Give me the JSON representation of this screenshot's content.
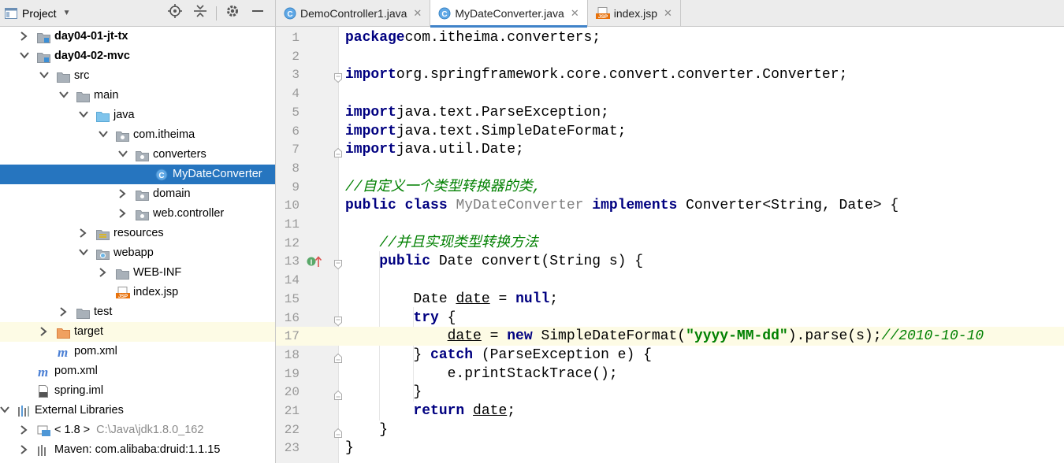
{
  "project_panel": {
    "title": "Project",
    "tools": [
      "locate-icon",
      "collapse-icon",
      "gear-icon",
      "hide-icon"
    ],
    "tree": [
      {
        "label": "day04-01-jt-tx",
        "depth": 1,
        "expanded": false,
        "icon": "module-folder-icon",
        "bold": true
      },
      {
        "label": "day04-02-mvc",
        "depth": 1,
        "expanded": true,
        "icon": "module-folder-icon",
        "bold": true
      },
      {
        "label": "src",
        "depth": 2,
        "expanded": true,
        "icon": "folder-icon"
      },
      {
        "label": "main",
        "depth": 3,
        "expanded": true,
        "icon": "folder-icon"
      },
      {
        "label": "java",
        "depth": 4,
        "expanded": true,
        "icon": "source-folder-icon"
      },
      {
        "label": "com.itheima",
        "depth": 5,
        "expanded": true,
        "icon": "package-icon"
      },
      {
        "label": "converters",
        "depth": 6,
        "expanded": true,
        "icon": "package-icon"
      },
      {
        "label": "MyDateConverter",
        "depth": 7,
        "expanded": null,
        "icon": "class-icon",
        "selected": true
      },
      {
        "label": "domain",
        "depth": 6,
        "expanded": false,
        "icon": "package-icon"
      },
      {
        "label": "web.controller",
        "depth": 6,
        "expanded": false,
        "icon": "package-icon"
      },
      {
        "label": "resources",
        "depth": 4,
        "expanded": false,
        "icon": "resources-folder-icon"
      },
      {
        "label": "webapp",
        "depth": 4,
        "expanded": true,
        "icon": "web-folder-icon"
      },
      {
        "label": "WEB-INF",
        "depth": 5,
        "expanded": false,
        "icon": "folder-icon"
      },
      {
        "label": "index.jsp",
        "depth": 5,
        "expanded": null,
        "icon": "jsp-icon"
      },
      {
        "label": "test",
        "depth": 3,
        "expanded": false,
        "icon": "folder-icon"
      },
      {
        "label": "target",
        "depth": 2,
        "expanded": false,
        "icon": "excluded-folder-icon",
        "highlight": true
      },
      {
        "label": "pom.xml",
        "depth": 2,
        "expanded": null,
        "icon": "maven-icon"
      },
      {
        "label": "pom.xml",
        "depth": 1,
        "expanded": null,
        "icon": "maven-icon"
      },
      {
        "label": "spring.iml",
        "depth": 1,
        "expanded": null,
        "icon": "iml-icon"
      },
      {
        "label": "External Libraries",
        "depth": 0,
        "expanded": true,
        "icon": "libraries-icon"
      },
      {
        "label": "< 1.8 >",
        "suffix": "C:\\Java\\jdk1.8.0_162",
        "depth": 1,
        "expanded": false,
        "icon": "jdk-icon"
      },
      {
        "label": "Maven: com.alibaba:druid:1.1.15",
        "depth": 1,
        "expanded": false,
        "icon": "library-icon"
      }
    ]
  },
  "tabs": [
    {
      "label": "DemoController1.java",
      "icon": "class-icon",
      "active": false
    },
    {
      "label": "MyDateConverter.java",
      "icon": "class-icon",
      "active": true
    },
    {
      "label": "index.jsp",
      "icon": "jsp-icon",
      "active": false
    }
  ],
  "editor": {
    "current_line": 17,
    "lines": [
      {
        "n": "1",
        "tokens": [
          [
            "kw",
            "package"
          ],
          [
            "",
            "com.itheima.converters;"
          ]
        ]
      },
      {
        "n": "2",
        "tokens": []
      },
      {
        "n": "3",
        "fold": "open",
        "tokens": [
          [
            "kw",
            "import"
          ],
          [
            "",
            "org.springframework.core.convert.converter.Converter;"
          ]
        ]
      },
      {
        "n": "4",
        "tokens": []
      },
      {
        "n": "5",
        "tokens": [
          [
            "kw",
            "import"
          ],
          [
            "",
            "java.text.ParseException;"
          ]
        ]
      },
      {
        "n": "6",
        "tokens": [
          [
            "kw",
            "import"
          ],
          [
            "",
            "java.text.SimpleDateFormat;"
          ]
        ]
      },
      {
        "n": "7",
        "fold": "close",
        "tokens": [
          [
            "kw",
            "import"
          ],
          [
            "",
            "java.util.Date;"
          ]
        ]
      },
      {
        "n": "8",
        "tokens": []
      },
      {
        "n": "9",
        "tokens": [
          [
            "cmt",
            "//自定义一个类型转换器的类,"
          ]
        ]
      },
      {
        "n": "10",
        "tokens": [
          [
            "kw",
            "public"
          ],
          [
            "",
            " "
          ],
          [
            "kw",
            "class"
          ],
          [
            "",
            " "
          ],
          [
            "unused",
            "MyDateConverter"
          ],
          [
            "",
            " "
          ],
          [
            "kw",
            "implements"
          ],
          [
            "",
            " Converter<String, Date> {"
          ]
        ]
      },
      {
        "n": "11",
        "tokens": []
      },
      {
        "n": "12",
        "tokens": [
          [
            "",
            "    "
          ],
          [
            "cmt",
            "//并且实现类型转换方法"
          ]
        ]
      },
      {
        "n": "13",
        "fold": "open",
        "mark": true,
        "tokens": [
          [
            "",
            "    "
          ],
          [
            "kw",
            "public"
          ],
          [
            "",
            " Date convert(String s) {"
          ]
        ]
      },
      {
        "n": "14",
        "tokens": []
      },
      {
        "n": "15",
        "tokens": [
          [
            "",
            "        Date "
          ],
          [
            "under",
            "date"
          ],
          [
            "",
            " = "
          ],
          [
            "kw",
            "null"
          ],
          [
            "",
            ";"
          ]
        ]
      },
      {
        "n": "16",
        "fold": "open",
        "tokens": [
          [
            "",
            "        "
          ],
          [
            "kw",
            "try"
          ],
          [
            "",
            " {"
          ]
        ]
      },
      {
        "n": "17",
        "tokens": [
          [
            "",
            "            "
          ],
          [
            "under",
            "date"
          ],
          [
            "",
            " = "
          ],
          [
            "kw",
            "new"
          ],
          [
            "",
            " SimpleDateFormat("
          ],
          [
            "str",
            "\"yyyy-MM-dd\""
          ],
          [
            "",
            ").parse(s);"
          ],
          [
            "cmt",
            "//2010-10-10"
          ]
        ]
      },
      {
        "n": "18",
        "fold": "close",
        "tokens": [
          [
            "",
            "        } "
          ],
          [
            "kw",
            "catch"
          ],
          [
            "",
            " (ParseException e) {"
          ]
        ]
      },
      {
        "n": "19",
        "tokens": [
          [
            "",
            "            e.printStackTrace();"
          ]
        ]
      },
      {
        "n": "20",
        "fold": "close",
        "tokens": [
          [
            "",
            "        }"
          ]
        ]
      },
      {
        "n": "21",
        "tokens": [
          [
            "",
            "        "
          ],
          [
            "kw",
            "return"
          ],
          [
            "",
            " "
          ],
          [
            "under",
            "date"
          ],
          [
            "",
            ";"
          ]
        ]
      },
      {
        "n": "22",
        "fold": "close",
        "tokens": [
          [
            "",
            "    }"
          ]
        ]
      },
      {
        "n": "23",
        "tokens": [
          [
            "",
            "}"
          ]
        ]
      }
    ]
  },
  "colors": {
    "keyword": "#000080",
    "string": "#008000",
    "comment": "#008000",
    "selection": "#2675bf",
    "current_line": "#fdfbe5"
  }
}
